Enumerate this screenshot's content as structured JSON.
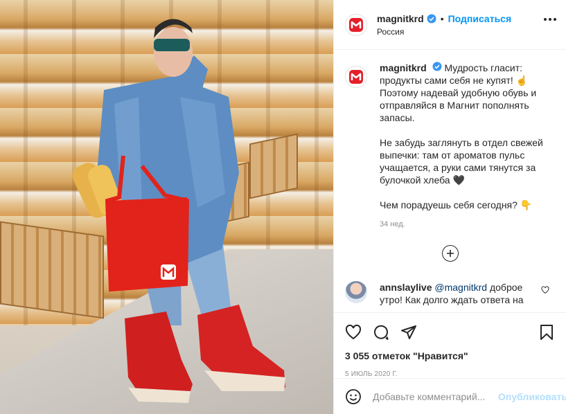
{
  "post": {
    "username": "magnitkrd",
    "follow_label": "Подписаться",
    "separator": "•",
    "location": "Россия",
    "caption": {
      "first_line": "Мудрость гласит: продукты сами себя не купят! ☝️ Поэтому надевай удобную обувь и отправляйся в Магнит пополнять запасы.",
      "second": "Не забудь заглянуть в отдел свежей выпечки: там от ароматов пульс учащается, а руки сами тянутся за булочкой хлеба 🖤",
      "third": "Чем порадуешь себя сегодня? 👇"
    },
    "caption_time": "34 нед.",
    "comment": {
      "username": "annslaylive",
      "mention": "@magnitkrd",
      "text": " доброе утро! Как долго ждать ответа на"
    },
    "likes": "3 055 отметок \"Нравится\"",
    "date": "5 ИЮЛЬ 2020 Г.",
    "add_comment_placeholder": "Добавьте комментарий...",
    "publish_label": "Опубликовать"
  },
  "icons": {
    "brand_logo": "magnit-logo-icon",
    "verified": "verified-badge-icon",
    "more": "more-options-icon",
    "load_more": "plus-circle-icon",
    "like": "heart-icon",
    "comment": "comment-icon",
    "share": "share-icon",
    "save": "bookmark-icon",
    "emoji": "emoji-icon"
  },
  "colors": {
    "brand_red": "#e4202a",
    "link_blue": "#0095f6",
    "verified_blue": "#3897f0",
    "muted": "#8e8e8e"
  }
}
